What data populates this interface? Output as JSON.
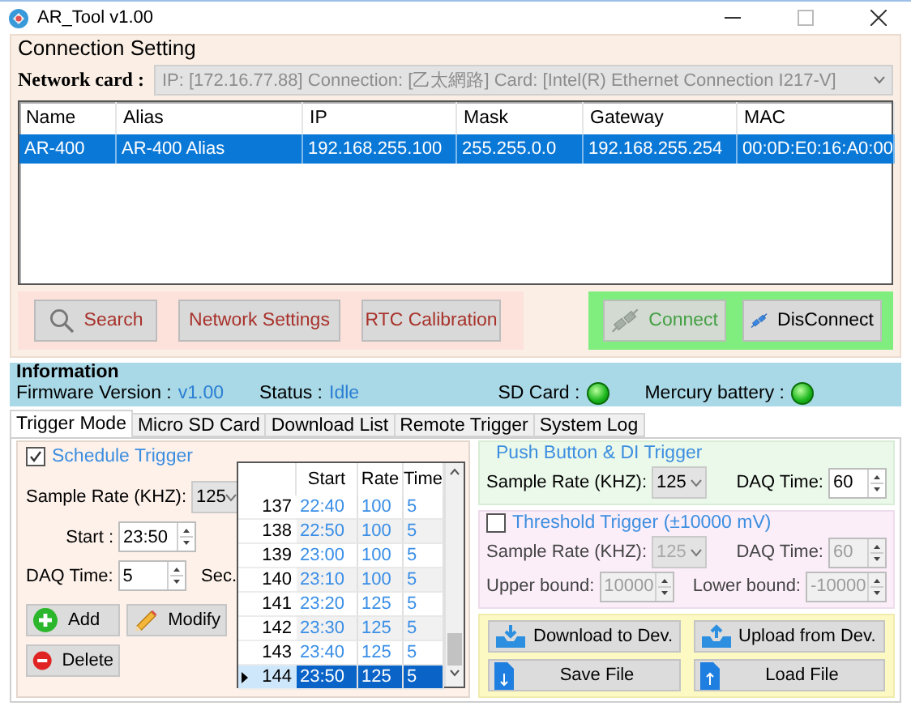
{
  "window": {
    "title": "AR_Tool v1.00"
  },
  "connection": {
    "title": "Connection Setting",
    "network_card": {
      "label": "Network card :",
      "value": "IP: [172.16.77.88] Connection: [乙太網路] Card: [Intel(R) Ethernet Connection I217-V]",
      "disabled": true
    },
    "devices": {
      "columns": [
        "Name",
        "Alias",
        "IP",
        "Mask",
        "Gateway",
        "MAC"
      ],
      "rows": [
        {
          "cells": [
            "AR-400",
            "AR-400 Alias",
            "192.168.255.100",
            "255.255.0.0",
            "192.168.255.254",
            "00:0D:E0:16:A0:00"
          ],
          "selected": true
        }
      ]
    },
    "buttons": [
      {
        "label": "Search",
        "kind": "search"
      },
      {
        "label": "Network Settings",
        "kind": "plain"
      },
      {
        "label": "RTC Calibration",
        "kind": "plain"
      }
    ],
    "link_buttons": [
      {
        "label": "Connect",
        "kind": "connect",
        "disabled": true
      },
      {
        "label": "DisConnect",
        "kind": "disconnect",
        "disabled": false
      }
    ]
  },
  "information": {
    "title": "Information",
    "fields": [
      {
        "label": "Firmware Version :",
        "value": "v1.00"
      },
      {
        "label": "Status :",
        "value": "Idle"
      }
    ],
    "indicators": [
      {
        "label": "SD Card :",
        "on": true
      },
      {
        "label": "Mercury battery :",
        "on": true
      }
    ]
  },
  "tabs": [
    {
      "label": "Trigger Mode",
      "selected": true
    },
    {
      "label": "Micro SD Card",
      "selected": false
    },
    {
      "label": "Download List",
      "selected": false
    },
    {
      "label": "Remote Trigger",
      "selected": false
    },
    {
      "label": "System Log",
      "selected": false
    }
  ],
  "schedule": {
    "title": "Schedule Trigger",
    "checked": true,
    "sample_rate_label": "Sample Rate (KHZ):",
    "sample_rate": "125",
    "start_label": "Start :",
    "start": "23:50",
    "daq_label": "DAQ Time:",
    "daq": "5",
    "daq_unit": "Sec.",
    "buttons": [
      {
        "label": "Add",
        "kind": "add"
      },
      {
        "label": "Modify",
        "kind": "modify"
      },
      {
        "label": "Delete",
        "kind": "delete"
      }
    ],
    "table": {
      "columns": [
        "Start",
        "Rate",
        "Time"
      ],
      "rows": [
        {
          "index": "137",
          "cells": [
            "22:40",
            "100",
            "5"
          ],
          "selected": false
        },
        {
          "index": "138",
          "cells": [
            "22:50",
            "100",
            "5"
          ],
          "selected": false
        },
        {
          "index": "139",
          "cells": [
            "23:00",
            "100",
            "5"
          ],
          "selected": false
        },
        {
          "index": "140",
          "cells": [
            "23:10",
            "100",
            "5"
          ],
          "selected": false
        },
        {
          "index": "141",
          "cells": [
            "23:20",
            "125",
            "5"
          ],
          "selected": false
        },
        {
          "index": "142",
          "cells": [
            "23:30",
            "125",
            "5"
          ],
          "selected": false
        },
        {
          "index": "143",
          "cells": [
            "23:40",
            "125",
            "5"
          ],
          "selected": false
        },
        {
          "index": "144",
          "cells": [
            "23:50",
            "125",
            "5"
          ],
          "selected": true
        }
      ]
    }
  },
  "push_trigger": {
    "title": "Push Button & DI Trigger",
    "sample_rate_label": "Sample Rate (KHZ):",
    "sample_rate": "125",
    "daq_label": "DAQ Time:",
    "daq": "60"
  },
  "threshold_trigger": {
    "title": "Threshold Trigger (±10000 mV)",
    "checked": false,
    "disabled": true,
    "sample_rate_label": "Sample Rate (KHZ):",
    "sample_rate": "125",
    "daq_label": "DAQ Time:",
    "daq": "60",
    "upper_label": "Upper bound:",
    "upper": "10000",
    "lower_label": "Lower bound:",
    "lower": "-10000"
  },
  "file_buttons": [
    {
      "label": "Download to Dev.",
      "kind": "download"
    },
    {
      "label": "Upload from Dev.",
      "kind": "upload"
    },
    {
      "label": "Save File",
      "kind": "save"
    },
    {
      "label": "Load File",
      "kind": "load"
    }
  ]
}
